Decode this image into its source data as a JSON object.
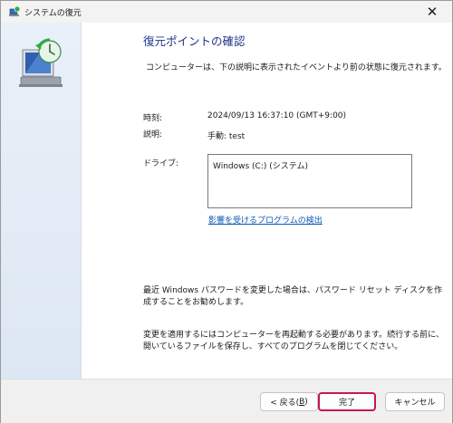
{
  "window": {
    "title": "システムの復元",
    "close_glyph": "✕"
  },
  "page": {
    "heading": "復元ポイントの確認",
    "description": "コンピューターは、下の説明に表示されたイベントより前の状態に復元されます。"
  },
  "details": {
    "time_label": "時刻:",
    "time_value": "2024/09/13 16:37:10 (GMT+9:00)",
    "description_label": "説明:",
    "description_value": "手動: test",
    "drive_label": "ドライブ:",
    "drive_value": "Windows (C:) (システム)",
    "scan_link": "影響を受けるプログラムの検出"
  },
  "notes": {
    "password_note": "最近 Windows パスワードを変更した場合は、パスワード リセット ディスクを作成することをお勧めします。",
    "restart_note": "変更を適用するにはコンピューターを再起動する必要があります。続行する前に、開いているファイルを保存し、すべてのプログラムを閉じてください。"
  },
  "buttons": {
    "back_text": "< 戻る(",
    "back_key": "B",
    "back_close": ")",
    "finish": "完了",
    "cancel": "キャンセル"
  },
  "colors": {
    "heading": "#1e3287",
    "link": "#0b57b5",
    "focus_border": "#c2185b"
  },
  "icons": {
    "title": "system-restore-icon",
    "hero": "computer-restore-icon"
  }
}
